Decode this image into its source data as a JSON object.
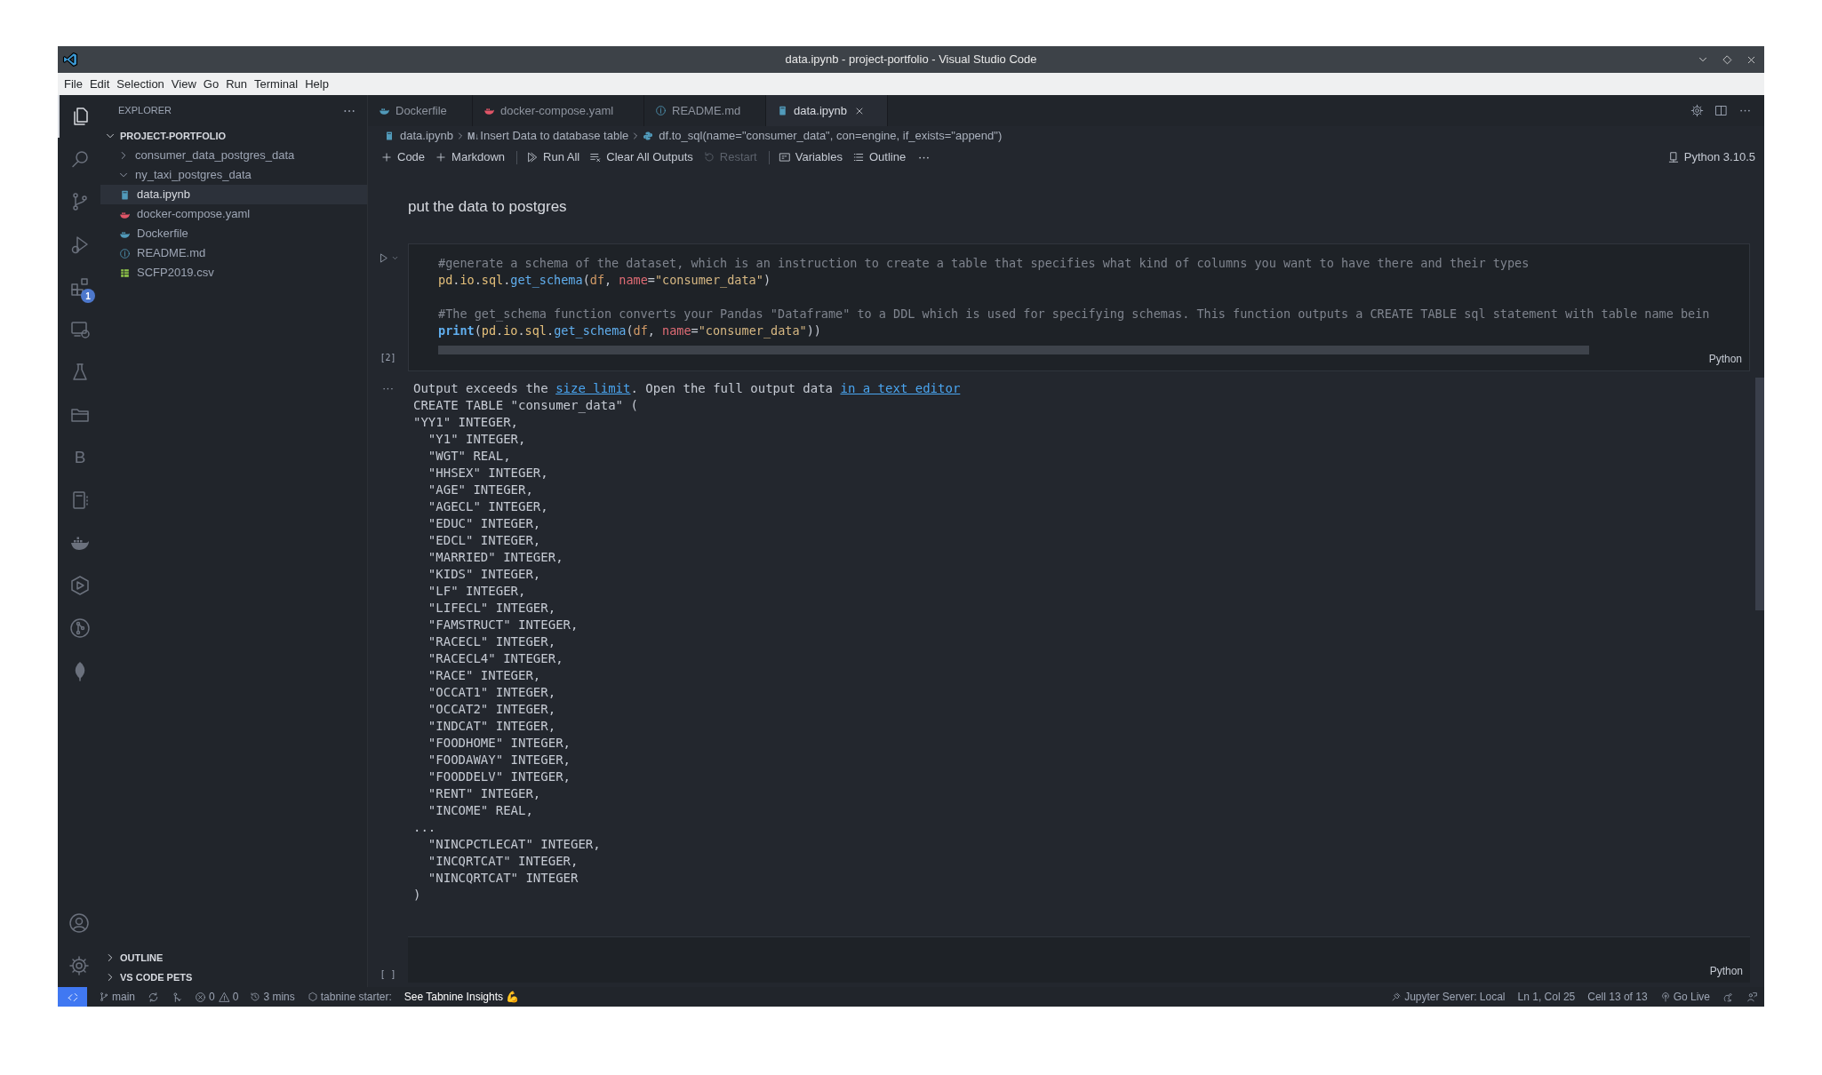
{
  "window": {
    "title": "data.ipynb - project-portfolio - Visual Studio Code"
  },
  "menu": [
    "File",
    "Edit",
    "Selection",
    "View",
    "Go",
    "Run",
    "Terminal",
    "Help"
  ],
  "activity_bar": {
    "items": [
      {
        "selected": true
      },
      {
        "selected": false
      },
      {
        "selected": false
      },
      {
        "selected": false
      },
      {
        "selected": false,
        "badge": "1"
      },
      {
        "selected": false
      },
      {
        "selected": false
      },
      {
        "selected": false
      },
      {
        "selected": false,
        "glyph": "B"
      },
      {
        "selected": false
      },
      {
        "selected": false
      },
      {
        "selected": false
      },
      {
        "selected": false
      },
      {
        "selected": false
      }
    ]
  },
  "sidebar": {
    "title": "EXPLORER",
    "root": {
      "label": "PROJECT-PORTFOLIO",
      "expanded": true
    },
    "items": [
      {
        "label": "consumer_data_postgres_data",
        "kind": "folder",
        "expanded": false,
        "selected": false
      },
      {
        "label": "ny_taxi_postgres_data",
        "kind": "folder",
        "expanded": true,
        "selected": false
      },
      {
        "label": "data.ipynb",
        "kind": "notebook",
        "selected": true
      },
      {
        "label": "docker-compose.yaml",
        "kind": "compose",
        "selected": false
      },
      {
        "label": "Dockerfile",
        "kind": "docker",
        "selected": false
      },
      {
        "label": "README.md",
        "kind": "info",
        "selected": false
      },
      {
        "label": "SCFP2019.csv",
        "kind": "csv",
        "selected": false
      }
    ],
    "sections": [
      {
        "label": "OUTLINE",
        "expanded": false
      },
      {
        "label": "VS CODE PETS",
        "expanded": false
      }
    ]
  },
  "tabs": [
    {
      "label": "Dockerfile",
      "kind": "docker",
      "selected": false
    },
    {
      "label": "docker-compose.yaml",
      "kind": "compose",
      "selected": false
    },
    {
      "label": "README.md",
      "kind": "info",
      "selected": false
    },
    {
      "label": "data.ipynb",
      "kind": "notebook",
      "selected": true
    }
  ],
  "breadcrumb": [
    {
      "kind": "notebook",
      "label": "data.ipynb"
    },
    {
      "kind": "markdown",
      "prefix": "M↓",
      "label": "Insert Data to database table"
    },
    {
      "kind": "python",
      "label": "df.to_sql(name=\"consumer_data\", con=engine, if_exists=\"append\")"
    }
  ],
  "toolbar": [
    {
      "kind": "plus",
      "label": "Code",
      "disabled": false
    },
    {
      "kind": "plus",
      "label": "Markdown",
      "disabled": false
    },
    {
      "kind": "runall",
      "label": "Run All",
      "disabled": false
    },
    {
      "kind": "clear",
      "label": "Clear All Outputs",
      "disabled": false
    },
    {
      "kind": "restart",
      "label": "Restart",
      "disabled": true
    },
    {
      "kind": "variables",
      "label": "Variables",
      "disabled": false
    },
    {
      "kind": "outline",
      "label": "Outline",
      "disabled": false
    }
  ],
  "kernel": "Python 3.10.5",
  "markdown_cell": "put the data to postgres",
  "code_cell": {
    "execution": "[2]",
    "language": "Python",
    "blocks": [
      [
        [
          {
            "text": "#generate a schema of the dataset, which is an instruction to create a table that specifies what kind of columns you want to have there and their types",
            "kind": "comment"
          }
        ],
        [
          {
            "text": "pd",
            "kind": "module"
          },
          {
            "text": ".",
            "kind": "punct"
          },
          {
            "text": "io",
            "kind": "module"
          },
          {
            "text": ".",
            "kind": "punct"
          },
          {
            "text": "sql",
            "kind": "module"
          },
          {
            "text": ".",
            "kind": "punct"
          },
          {
            "text": "get_schema",
            "kind": "func"
          },
          {
            "text": "(",
            "kind": "punct"
          },
          {
            "text": "df",
            "kind": "var"
          },
          {
            "text": ", ",
            "kind": "punct"
          },
          {
            "text": "name",
            "kind": "param"
          },
          {
            "text": "=",
            "kind": "op"
          },
          {
            "text": "\"consumer_data\"",
            "kind": "string"
          },
          {
            "text": ")",
            "kind": "punct"
          }
        ]
      ],
      [
        [
          {
            "text": "#The get_schema function converts your Pandas \"Dataframe\" to a DDL which is used for specifying schemas. This function outputs a CREATE TABLE sql statement with table name bein",
            "kind": "comment"
          }
        ],
        [
          {
            "text": "print",
            "kind": "builtin"
          },
          {
            "text": "(",
            "kind": "punct"
          },
          {
            "text": "pd",
            "kind": "module"
          },
          {
            "text": ".",
            "kind": "punct"
          },
          {
            "text": "io",
            "kind": "module"
          },
          {
            "text": ".",
            "kind": "punct"
          },
          {
            "text": "sql",
            "kind": "module"
          },
          {
            "text": ".",
            "kind": "punct"
          },
          {
            "text": "get_schema",
            "kind": "func"
          },
          {
            "text": "(",
            "kind": "punct"
          },
          {
            "text": "df",
            "kind": "var"
          },
          {
            "text": ", ",
            "kind": "punct"
          },
          {
            "text": "name",
            "kind": "param"
          },
          {
            "text": "=",
            "kind": "op"
          },
          {
            "text": "\"consumer_data\"",
            "kind": "string"
          },
          {
            "text": "))",
            "kind": "punct"
          }
        ]
      ]
    ]
  },
  "output": {
    "more": "···",
    "notice": [
      {
        "kind": "text",
        "text": "Output exceeds the "
      },
      {
        "kind": "link",
        "text": "size limit"
      },
      {
        "kind": "text",
        "text": ". Open the full output data "
      },
      {
        "kind": "link",
        "text": "in a text editor"
      }
    ],
    "lines": [
      "CREATE TABLE \"consumer_data\" (",
      "\"YY1\" INTEGER,",
      "  \"Y1\" INTEGER,",
      "  \"WGT\" REAL,",
      "  \"HHSEX\" INTEGER,",
      "  \"AGE\" INTEGER,",
      "  \"AGECL\" INTEGER,",
      "  \"EDUC\" INTEGER,",
      "  \"EDCL\" INTEGER,",
      "  \"MARRIED\" INTEGER,",
      "  \"KIDS\" INTEGER,",
      "  \"LF\" INTEGER,",
      "  \"LIFECL\" INTEGER,",
      "  \"FAMSTRUCT\" INTEGER,",
      "  \"RACECL\" INTEGER,",
      "  \"RACECL4\" INTEGER,",
      "  \"RACE\" INTEGER,",
      "  \"OCCAT1\" INTEGER,",
      "  \"OCCAT2\" INTEGER,",
      "  \"INDCAT\" INTEGER,",
      "  \"FOODHOME\" INTEGER,",
      "  \"FOODAWAY\" INTEGER,",
      "  \"FOODDELV\" INTEGER,",
      "  \"RENT\" INTEGER,",
      "  \"INCOME\" REAL,",
      "...",
      "  \"NINCPCTLECAT\" INTEGER,",
      "  \"INCQRTCAT\" INTEGER,",
      "  \"NINCQRTCAT\" INTEGER",
      ")"
    ]
  },
  "empty_cell": {
    "execution": "[ ]",
    "language": "Python"
  },
  "status_bar": {
    "left": [
      {
        "kind": "branch",
        "text": "main"
      },
      {
        "kind": "sync"
      },
      {
        "kind": "share"
      },
      {
        "kind": "problems",
        "errors": "0",
        "warnings": "0"
      },
      {
        "kind": "history",
        "text": "3 mins"
      },
      {
        "kind": "tabnine",
        "text": "tabnine starter:"
      },
      {
        "kind": "plain",
        "text": "See Tabnine Insights 💪"
      }
    ],
    "right": [
      {
        "kind": "jupyter",
        "text": "Jupyter Server: Local"
      },
      {
        "kind": "plain",
        "text": "Ln 1, Col 25"
      },
      {
        "kind": "plain",
        "text": "Cell 13 of 13"
      },
      {
        "kind": "golive",
        "text": "Go Live"
      },
      {
        "kind": "pets"
      },
      {
        "kind": "feedback"
      }
    ]
  }
}
